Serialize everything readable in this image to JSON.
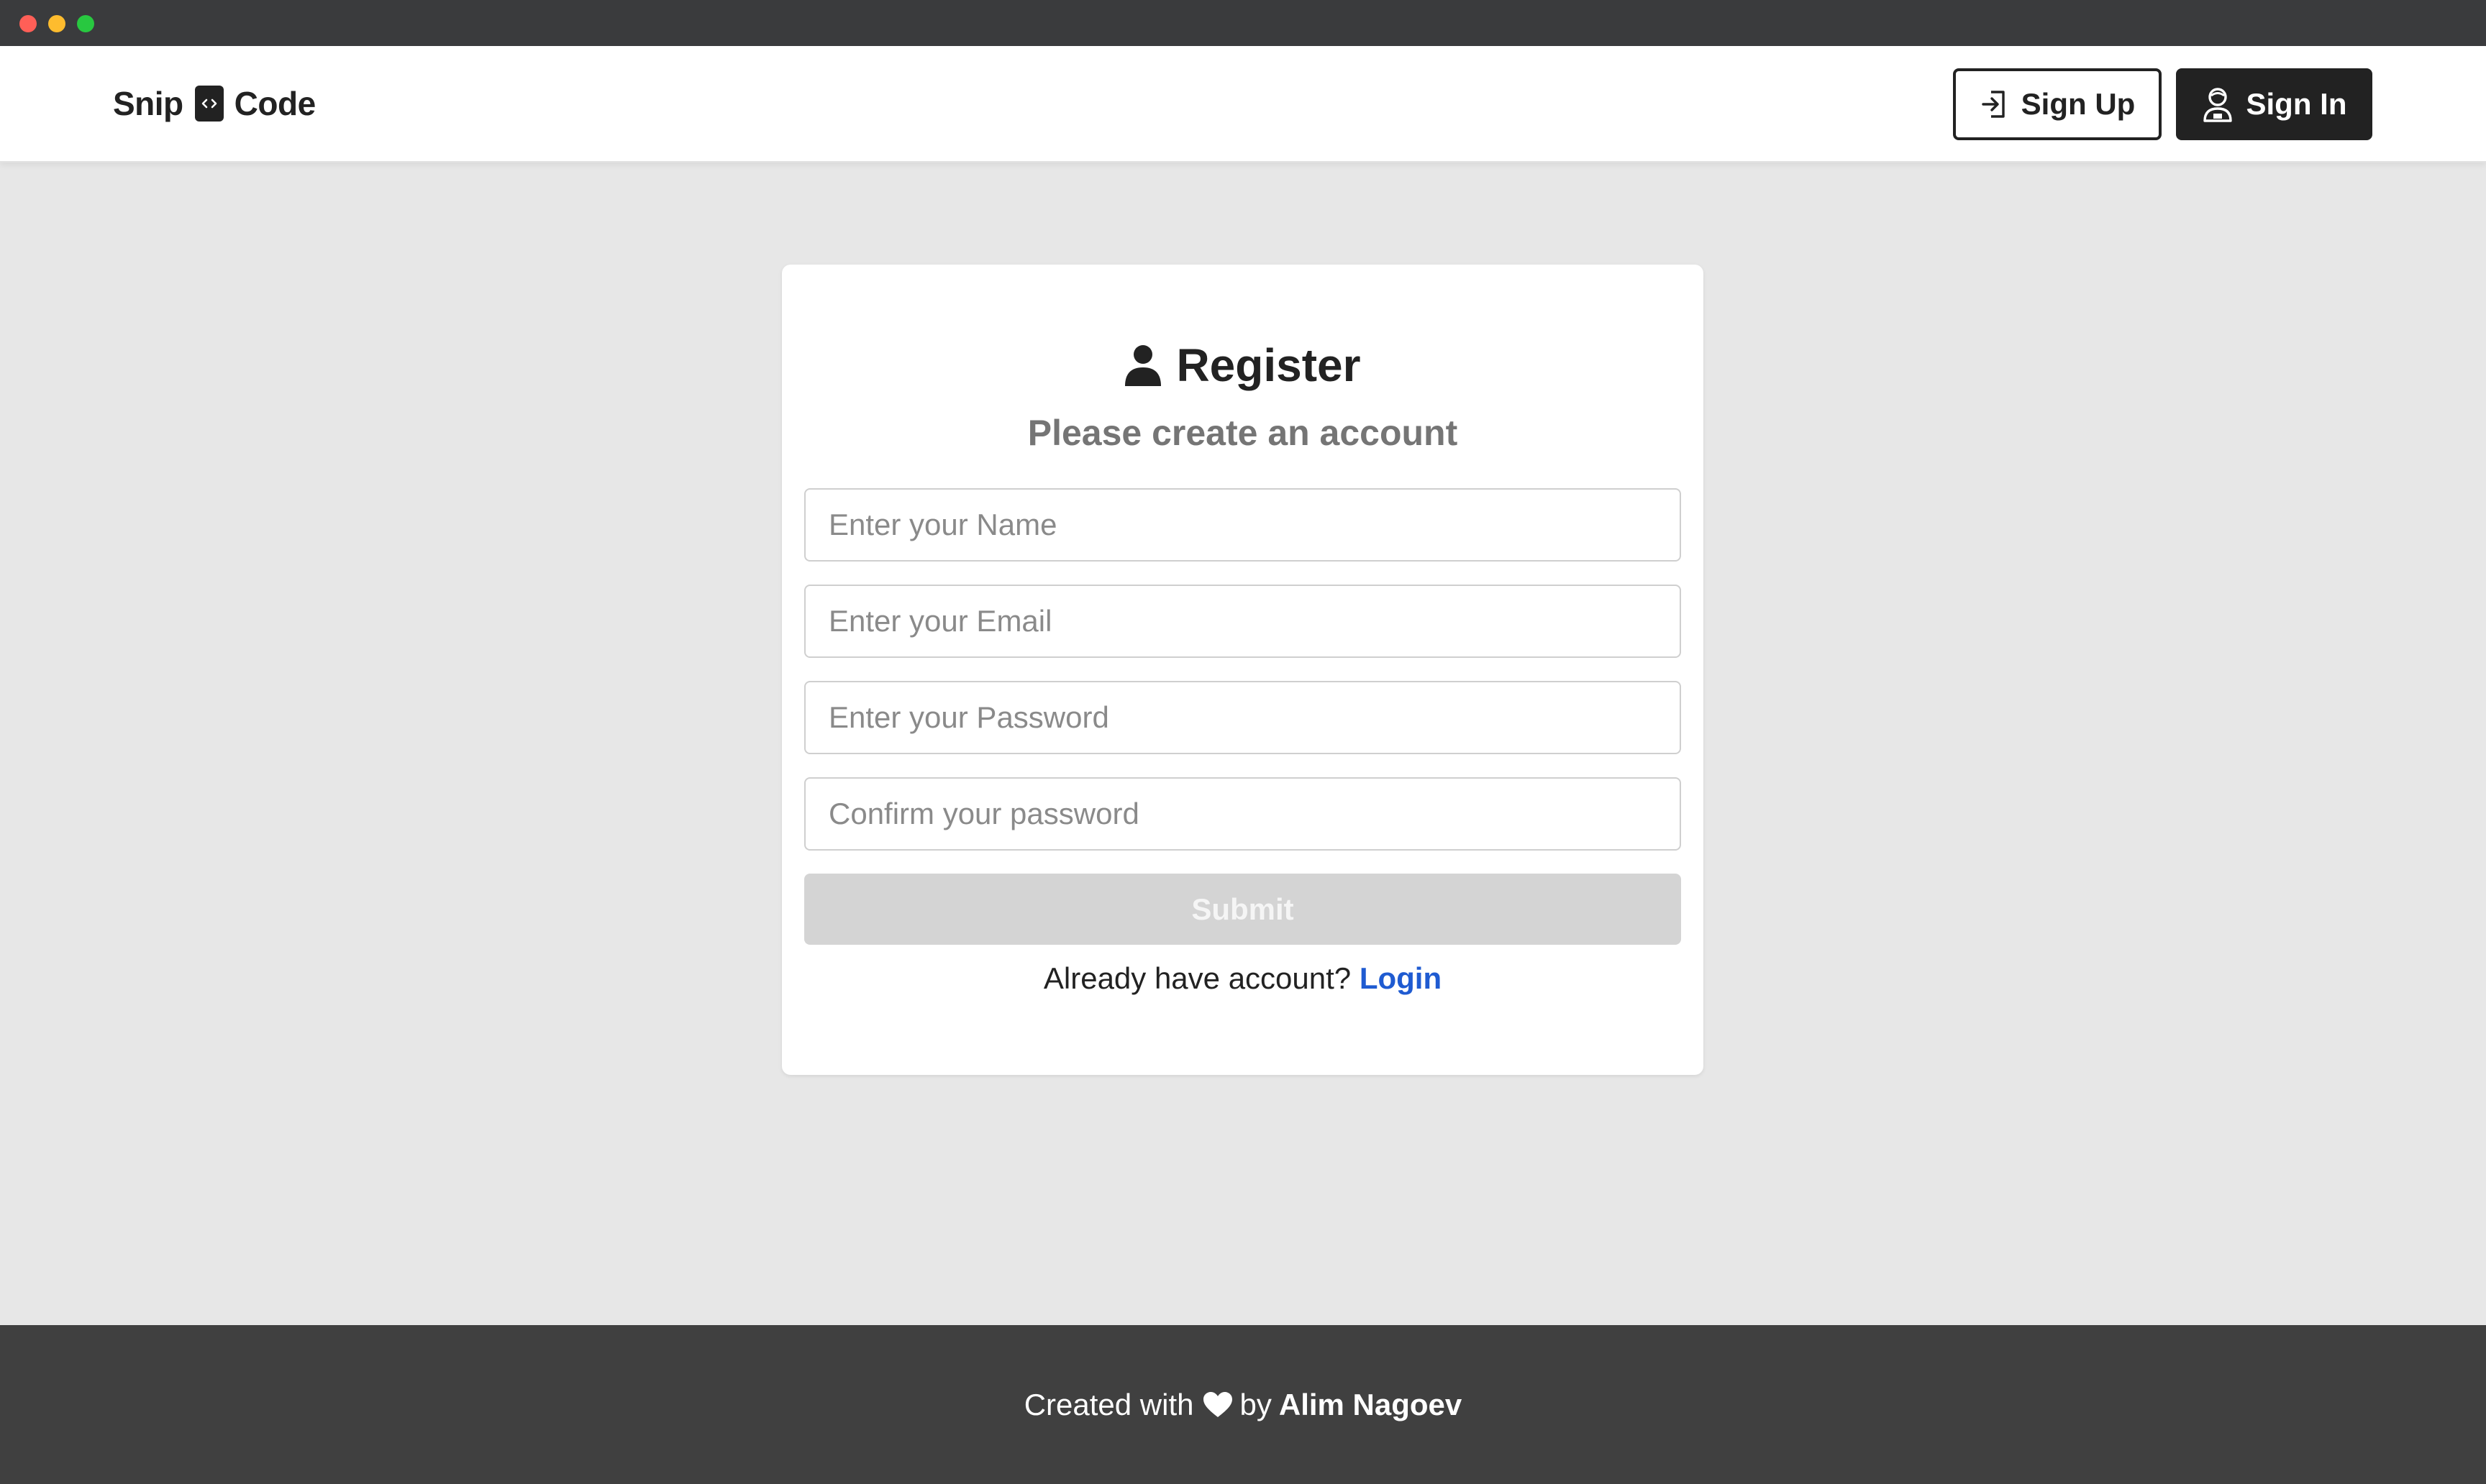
{
  "window": {
    "controls": [
      "close",
      "minimize",
      "maximize"
    ]
  },
  "header": {
    "logo": {
      "left_text": "Snip",
      "icon": "code-brackets-icon",
      "right_text": "Code"
    },
    "signup": {
      "label": "Sign Up",
      "icon": "sign-in-arrow-icon"
    },
    "signin": {
      "label": "Sign In",
      "icon": "user-avatar-icon"
    }
  },
  "form": {
    "title": "Register",
    "title_icon": "user-icon",
    "subtitle": "Please create an account",
    "name_placeholder": "Enter your Name",
    "email_placeholder": "Enter your Email",
    "password_placeholder": "Enter your Password",
    "confirm_placeholder": "Confirm your password",
    "submit_label": "Submit",
    "login_prompt": "Already have account?",
    "login_link": "Login"
  },
  "footer": {
    "prefix": "Created with",
    "icon": "heart-icon",
    "by": "by",
    "author": "Alim Nagoev"
  },
  "colors": {
    "background": "#e7e7e7",
    "dark": "#222222",
    "footer": "#404040",
    "link": "#1f5bd1",
    "submit_disabled": "#d4d4d4"
  }
}
